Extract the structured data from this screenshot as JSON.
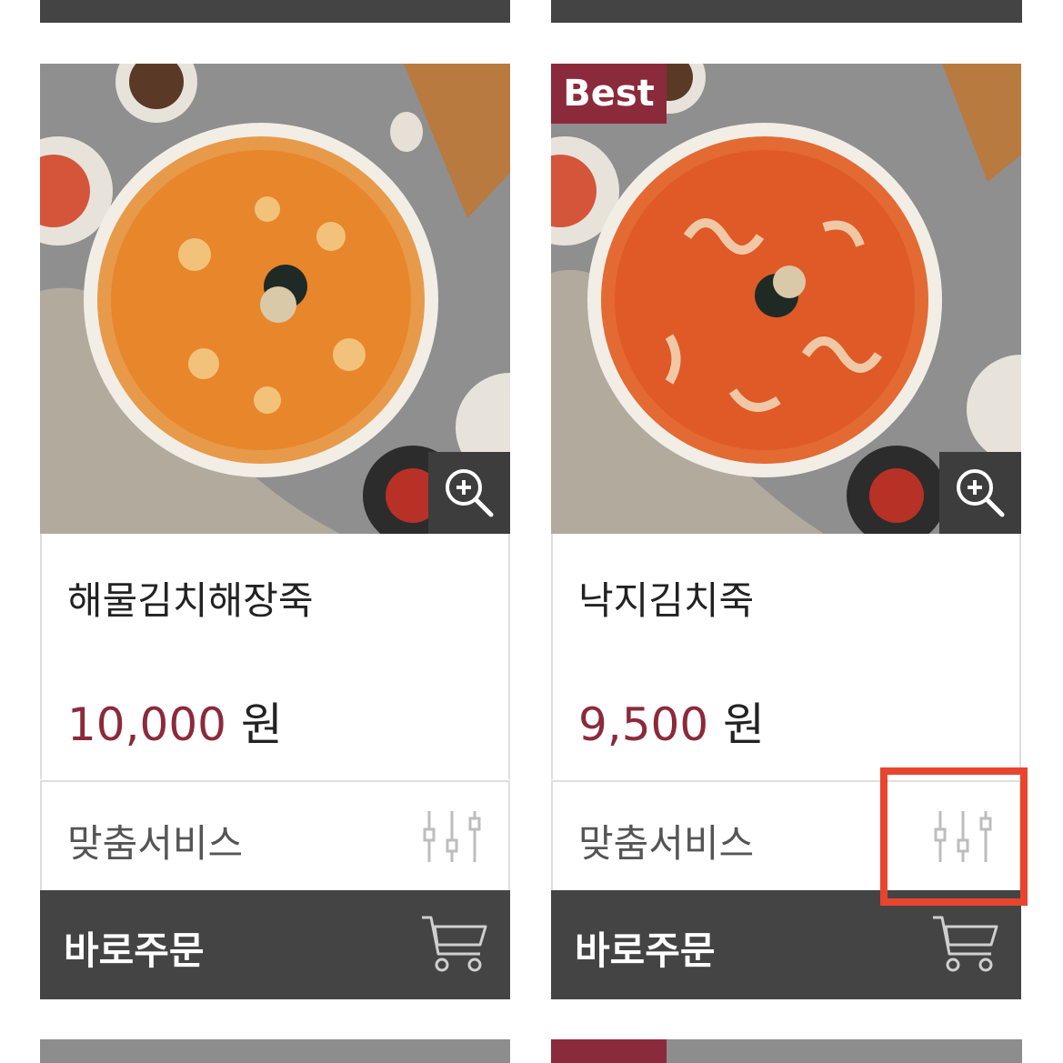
{
  "products": [
    {
      "name": "해물김치해장죽",
      "price": "10,000",
      "currency": "원",
      "badge": "",
      "service_label": "맞춤서비스",
      "order_label": "바로주문"
    },
    {
      "name": "낙지김치죽",
      "price": "9,500",
      "currency": "원",
      "badge": "Best",
      "service_label": "맞춤서비스",
      "order_label": "바로주문"
    }
  ],
  "colors": {
    "accent": "#8b2a3b",
    "dark_bar": "#444444",
    "highlight": "#e8452f"
  }
}
